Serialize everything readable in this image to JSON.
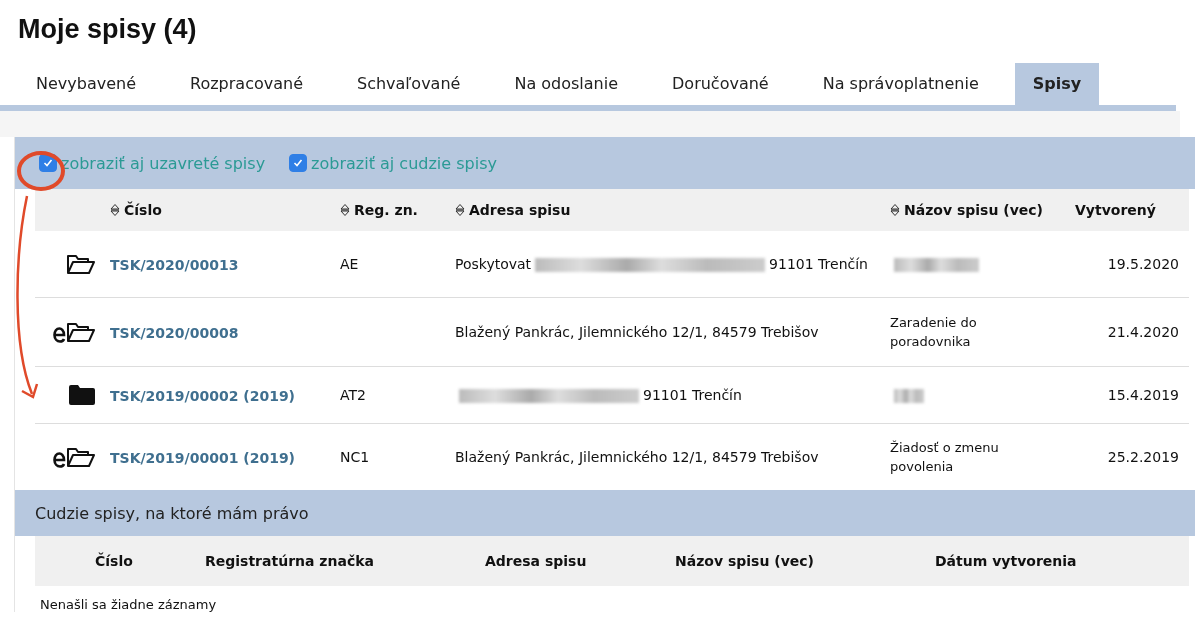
{
  "title": "Moje spisy (4)",
  "tabs": [
    {
      "label": "Nevybavené",
      "selected": false
    },
    {
      "label": "Rozpracované",
      "selected": false
    },
    {
      "label": "Schvaľované",
      "selected": false
    },
    {
      "label": "Na odoslanie",
      "selected": false
    },
    {
      "label": "Doručované",
      "selected": false
    },
    {
      "label": "Na správoplatnenie",
      "selected": false
    },
    {
      "label": "Spisy",
      "selected": true
    }
  ],
  "filters": [
    {
      "label": "zobraziť aj uzavreté spisy",
      "checked": true
    },
    {
      "label": "zobraziť aj cudzie spisy",
      "checked": true
    }
  ],
  "markup": {
    "kind": "circle-arrow"
  },
  "table": {
    "columns": [
      {
        "label": "Číslo",
        "sortable": true
      },
      {
        "label": "Reg. zn.",
        "sortable": true
      },
      {
        "label": "Adresa spisu",
        "sortable": true
      },
      {
        "label": "Názov spisu (vec)",
        "sortable": true
      },
      {
        "label": "Vytvorený",
        "sortable": false
      }
    ],
    "rows": [
      {
        "kind": "open",
        "number": "TSK/2020/00013",
        "reg": "AE",
        "address": [
          {
            "kind": "text",
            "text": "Poskytovat"
          },
          {
            "kind": "redacted"
          },
          {
            "kind": "text",
            "text": "91101 Trenčín"
          }
        ],
        "name": [
          {
            "kind": "redacted"
          }
        ],
        "created": "19.5.2020"
      },
      {
        "kind": "e-open",
        "number": "TSK/2020/00008",
        "address": [
          {
            "kind": "text",
            "text": "Blažený Pankrác, Jilemnického 12/1, 84579 Trebišov"
          }
        ],
        "name": [
          {
            "kind": "text",
            "text": "Zaradenie do poradovnika"
          }
        ],
        "created": "21.4.2020"
      },
      {
        "kind": "closed",
        "number": "TSK/2019/00002 (2019)",
        "reg": "AT2",
        "address": [
          {
            "kind": "redacted"
          },
          {
            "kind": "text",
            "text": "91101 Trenčín"
          }
        ],
        "name": [
          {
            "kind": "redacted"
          }
        ],
        "created": "15.4.2019"
      },
      {
        "kind": "e-open",
        "number": "TSK/2019/00001 (2019)",
        "reg": "NC1",
        "address": [
          {
            "kind": "text",
            "text": "Blažený Pankrác, Jilemnického 12/1, 84579 Trebišov"
          }
        ],
        "name": [
          {
            "kind": "text",
            "text": "Žiadosť o zmenu povolenia"
          }
        ],
        "created": "25.2.2019"
      }
    ]
  },
  "foreign": {
    "title": "Cudzie spisy, na ktoré mám právo",
    "columns": [
      "Číslo",
      "Registratúrna značka",
      "Adresa spisu",
      "Názov spisu (vec)",
      "Dátum vytvorenia"
    ],
    "empty": "Nenašli sa žiadne záznamy"
  }
}
